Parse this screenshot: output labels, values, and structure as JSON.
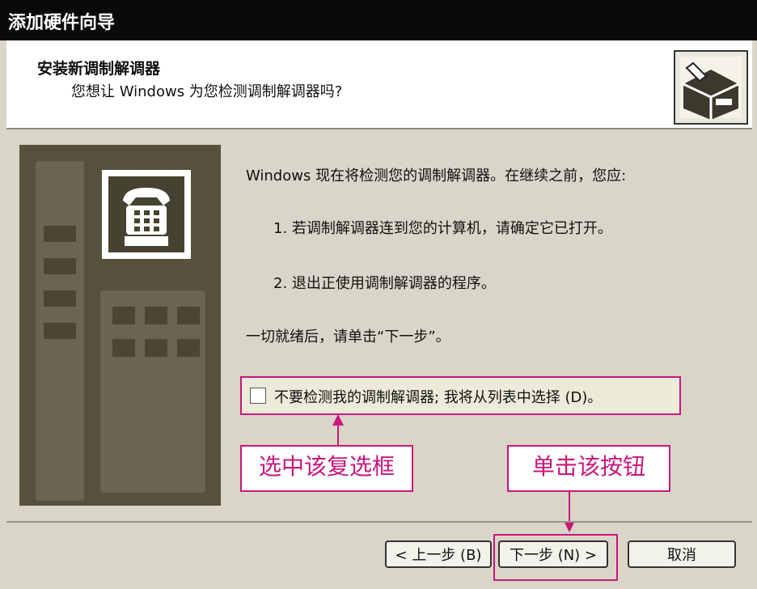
{
  "window": {
    "title": "添加硬件向导"
  },
  "header": {
    "title": "安装新调制解调器",
    "subtitle": "您想让 Windows 为您检测调制解调器吗?"
  },
  "content": {
    "intro": "Windows 现在将检测您的调制解调器。在继续之前，您应:",
    "step1": "1. 若调制解调器连到您的计算机，请确定它已打开。",
    "step2": "2. 退出正使用调制解调器的程序。",
    "ready": "一切就绪后，请单击“下一步”。"
  },
  "checkbox": {
    "label": "不要检测我的调制解调器; 我将从列表中选择 (D)。",
    "checked": false
  },
  "annotations": {
    "checkbox_note": "选中该复选框",
    "button_note": "单击该按钮",
    "color": "#c8177c"
  },
  "buttons": {
    "back": "< 上一步 (B)",
    "next": "下一步 (N) >",
    "cancel": "取消"
  },
  "icons": {
    "header_icon": "hardware-box-icon",
    "side_icon": "telephone-icon"
  }
}
